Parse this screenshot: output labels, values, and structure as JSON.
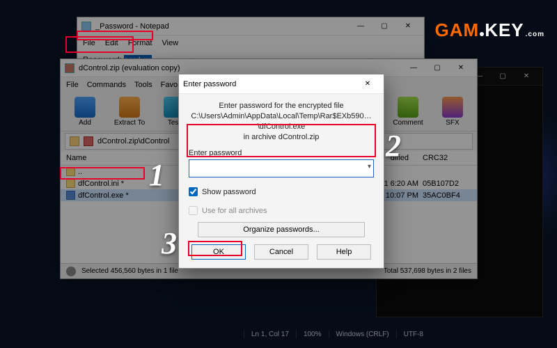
{
  "watermark": {
    "p1": "GAM",
    "p2": "KEY",
    "com": ".com"
  },
  "notepad": {
    "title": "_Password - Notepad",
    "menu": [
      "File",
      "Edit",
      "Format",
      "View"
    ],
    "label": "Password: ",
    "value": "sordum"
  },
  "winrar": {
    "title": "dControl.zip (evaluation copy)",
    "menu": [
      "File",
      "Commands",
      "Tools",
      "Favorites"
    ],
    "toolbar": {
      "add": "Add",
      "extract": "Extract To",
      "test": "Test",
      "comment": "Comment",
      "sfx": "SFX"
    },
    "path": "dControl.zip\\dControl",
    "columns": {
      "name": "Name",
      "modified": "dified",
      "crc": "CRC32"
    },
    "rows": [
      {
        "name": "..",
        "mod": "",
        "crc": ""
      },
      {
        "name": "dfControl.ini *",
        "mod": "3/2021 6:20 AM",
        "crc": "05B107D2"
      },
      {
        "name": "dfControl.exe *",
        "mod": "3/2021 10:07 PM",
        "crc": "35AC0BF4"
      }
    ],
    "status": {
      "sel": "Selected 456,560 bytes in 1 file",
      "total": "Total 537,698 bytes in 2 files"
    }
  },
  "dialog": {
    "title": "Enter password",
    "msg1": "Enter password for the encrypted file",
    "msg2": "C:\\Users\\Admin\\AppData\\Local\\Temp\\Rar$EXb590…\\dfControl.exe",
    "msg3": "in archive dControl.zip",
    "label": "Enter password",
    "value": "",
    "show": "Show password",
    "useall": "Use for all archives",
    "organize": "Organize passwords...",
    "ok": "OK",
    "cancel": "Cancel",
    "help": "Help"
  },
  "appstatus": {
    "pos": "Ln 1, Col 17",
    "zoom": "100%",
    "eol": "Windows (CRLF)",
    "enc": "UTF-8"
  },
  "steps": {
    "s1": "1",
    "s2": "2",
    "s3": "3"
  }
}
